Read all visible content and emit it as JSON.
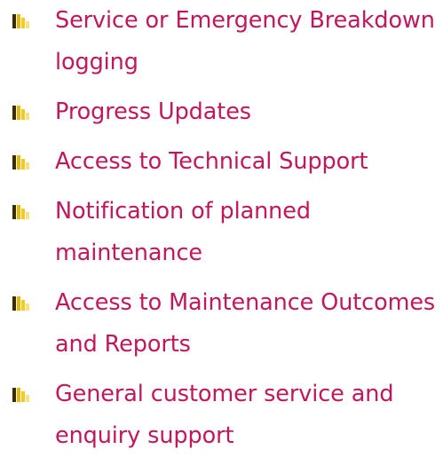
{
  "colors": {
    "text": "#c2185b",
    "bullet_gold": "#e8b800",
    "bullet_dark": "#3a2e00",
    "bullet_light": "#f7e27a"
  },
  "bullet_icon": "square-bullet-icon",
  "items": [
    {
      "label": "Service or Emergency Breakdown logging"
    },
    {
      "label": "Progress Updates"
    },
    {
      "label": "Access to Technical Support"
    },
    {
      "label": "Notification of planned maintenance"
    },
    {
      "label": "Access to Maintenance Outcomes and Reports"
    },
    {
      "label": "General customer service and enquiry support"
    }
  ]
}
